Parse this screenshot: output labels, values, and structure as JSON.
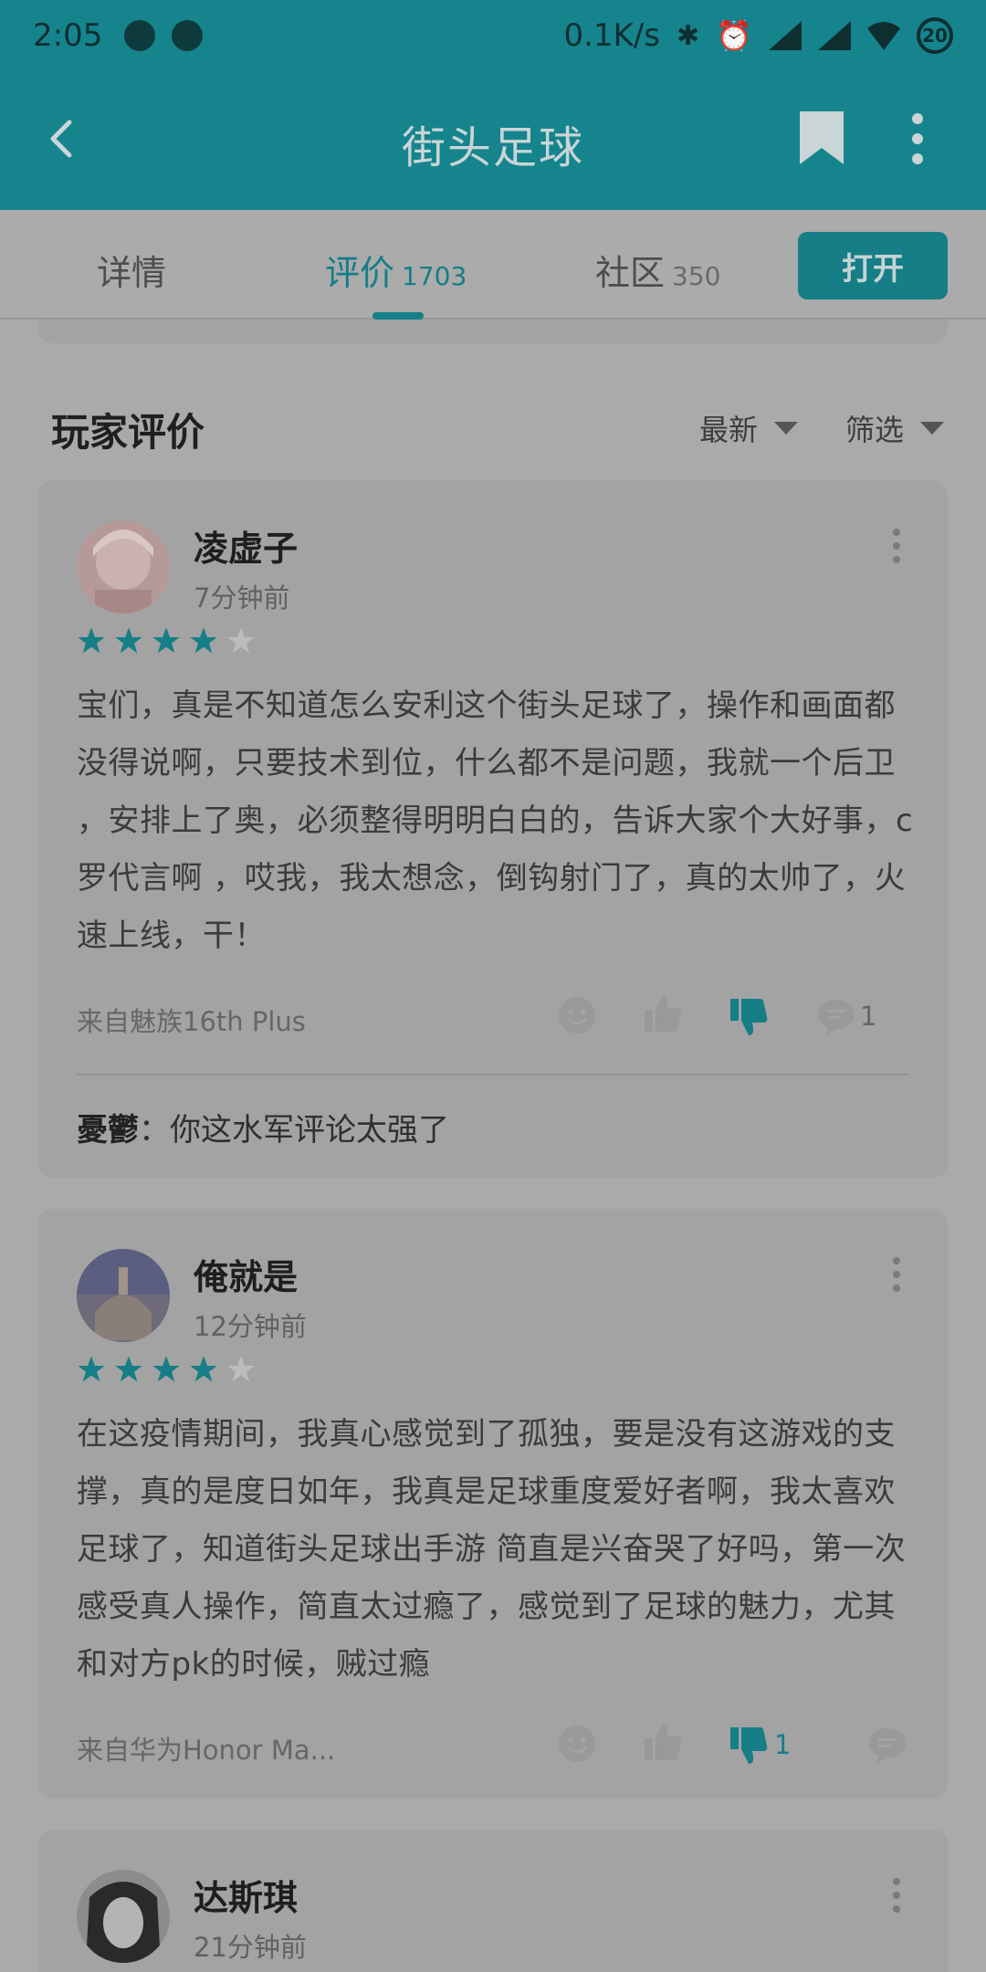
{
  "status_bar": {
    "time": "2:05",
    "speed": "0.1K/s",
    "battery": "20"
  },
  "app_bar": {
    "title": "街头足球",
    "icons": [
      "back-arrow-icon",
      "bookmark-icon",
      "more-vert-icon"
    ]
  },
  "tabs": [
    {
      "label": "详情",
      "count": ""
    },
    {
      "label": "评价",
      "count": "1703"
    },
    {
      "label": "社区",
      "count": "350"
    }
  ],
  "open_button": "打开",
  "section": {
    "title": "玩家评价",
    "sort_label": "最新",
    "filter_label": "筛选"
  },
  "colors": {
    "accent": "#157e87",
    "star_on": "#157e87",
    "star_off": "#c4c4c4"
  },
  "reviews": [
    {
      "username": "凌虚子",
      "time": "7分钟前",
      "rating": 4,
      "text": "宝们，真是不知道怎么安利这个街头足球了，操作和画面都没得说啊，只要技术到位，什么都不是问题，我就一个后卫 ，安排上了奥，必须整得明明白白的，告诉大家个大好事，c罗代言啊 ，哎我，我太想念，倒钩射门了，真的太帅了，火速上线，干！",
      "device": "来自魅族16th Plus",
      "dislike_count": "",
      "comment_count": "1",
      "reply_user": "憂鬱",
      "reply_text": "：你这水军评论太强了"
    },
    {
      "username": "俺就是",
      "time": "12分钟前",
      "rating": 4,
      "text": "在这疫情期间，我真心感觉到了孤独，要是没有这游戏的支撑，真的是度日如年，我真是足球重度爱好者啊，我太喜欢足球了，知道街头足球出手游 简直是兴奋哭了好吗，第一次感受真人操作，简直太过瘾了，感觉到了足球的魅力，尤其和对方pk的时候，贼过瘾",
      "device": "来自华为Honor Ma...",
      "dislike_count": "1",
      "comment_count": ""
    },
    {
      "username": "达斯琪",
      "time": "21分钟前"
    }
  ]
}
